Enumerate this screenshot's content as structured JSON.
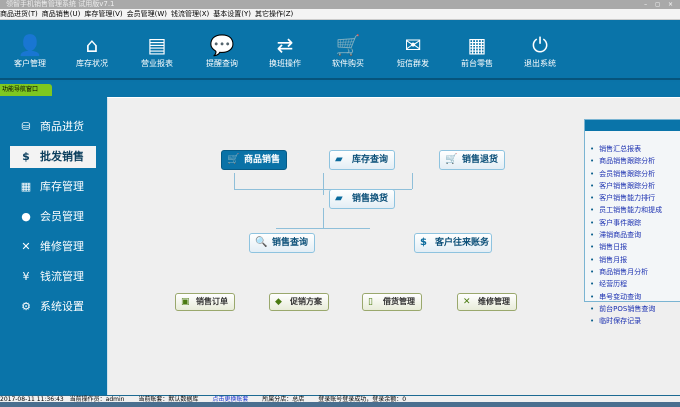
{
  "window": {
    "title": "领智手机销售管理系统 试用版v7.1",
    "controls": "– ◻ ×"
  },
  "menu": [
    "商品进货(T)",
    "商品销售(U)",
    "库存管理(V)",
    "会员管理(W)",
    "钱流管理(X)",
    "基本设置(Y)",
    "其它操作(Z)"
  ],
  "toolbar": [
    {
      "label": "客户管理",
      "icon": "user-circle-icon",
      "glyph": "👤"
    },
    {
      "label": "库存状况",
      "icon": "house-icon",
      "glyph": "⌂"
    },
    {
      "label": "营业报表",
      "icon": "notepad-icon",
      "glyph": "▤"
    },
    {
      "label": "提醒查询",
      "icon": "chat-user-icon",
      "glyph": "💬"
    },
    {
      "label": "换班操作",
      "icon": "swap-arrows-icon",
      "glyph": "⇄"
    },
    {
      "label": "软件购买",
      "icon": "cart-icon",
      "glyph": "🛒"
    },
    {
      "label": "短信群发",
      "icon": "envelope-icon",
      "glyph": "✉"
    },
    {
      "label": "前台零售",
      "icon": "cash-register-icon",
      "glyph": "▦"
    },
    {
      "label": "退出系统",
      "icon": "power-icon",
      "glyph": "⏻"
    }
  ],
  "nav_tab": "功能导航窗口",
  "sidebar": [
    {
      "label": "商品进货",
      "glyph": "⛁"
    },
    {
      "label": "批发销售",
      "glyph": "$",
      "active": true
    },
    {
      "label": "库存管理",
      "glyph": "▦"
    },
    {
      "label": "会员管理",
      "glyph": "●"
    },
    {
      "label": "维修管理",
      "glyph": "✕"
    },
    {
      "label": "钱流管理",
      "glyph": "¥"
    },
    {
      "label": "系统设置",
      "glyph": "⚙"
    }
  ],
  "flow": {
    "sales": "商品销售",
    "stock": "库存查询",
    "return": "销售退货",
    "exchange": "销售换货",
    "query": "销售查询",
    "accounts": "客户往来账务"
  },
  "quick": [
    "销售订单",
    "促销方案",
    "借货管理",
    "维修管理"
  ],
  "reports": [
    "销售汇总报表",
    "商品销售跟踪分析",
    "会员销售跟踪分析",
    "客户销售跟踪分析",
    "客户销售能力排行",
    "员工销售能力和提成",
    "客户事件跟踪",
    "滞销商品查询",
    "销售日报",
    "销售月报",
    "商品销售月分析",
    "经营历程",
    "串号变动查询",
    "前台POS销售查询",
    "临时保存记录"
  ],
  "status": {
    "datetime": "2017-08-11 11:36:43",
    "operator": "当前操作员：admin",
    "account": "当前账套：默认数据库",
    "switch_link": "点击更换账套",
    "branch": "所属分店：总店",
    "login": "登录账号登录成功，登录余额：0"
  },
  "colors": {
    "primary": "#0a74a9",
    "accent_green": "#7ec820"
  }
}
